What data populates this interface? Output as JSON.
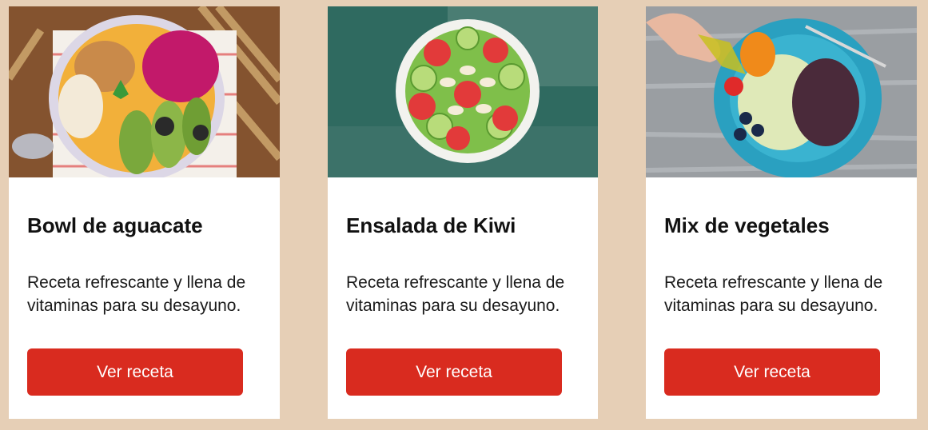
{
  "colors": {
    "background": "#e6cfb6",
    "card": "#ffffff",
    "button": "#d92b1f",
    "button_text": "#ffffff"
  },
  "cards": [
    {
      "image": "avocado-bowl-photo",
      "title": "Bowl de aguacate",
      "description": "Receta refrescante y llena de vitaminas para su desayuno.",
      "button_label": "Ver receta"
    },
    {
      "image": "kiwi-salad-photo",
      "title": "Ensalada de Kiwi",
      "description": "Receta refrescante y llena de vitaminas para su desayuno.",
      "button_label": "Ver receta"
    },
    {
      "image": "vegetable-mix-photo",
      "title": "Mix de vegetales",
      "description": "Receta refrescante y llena de vitaminas para su desayuno.",
      "button_label": "Ver receta"
    }
  ]
}
